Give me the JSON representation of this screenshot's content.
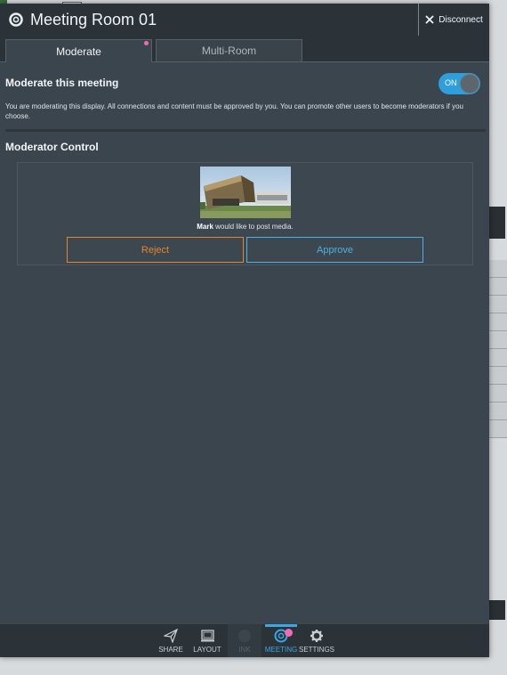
{
  "window": {
    "title": "Meeting Room 01",
    "disconnect_label": "Disconnect"
  },
  "tabs": [
    {
      "label": "Moderate",
      "active": true,
      "badge": true
    },
    {
      "label": "Multi-Room",
      "active": false
    }
  ],
  "moderate": {
    "heading": "Moderate this meeting",
    "toggle_label": "ON",
    "toggle_on": true,
    "description": "You are moderating this display. All connections and content must be approved by you. You can promote other users to become moderators if you choose."
  },
  "moderator_control": {
    "heading": "Moderator Control",
    "request": {
      "user": "Mark",
      "message": " would like to post media.",
      "reject_label": "Reject",
      "approve_label": "Approve"
    }
  },
  "toolbar": {
    "items": [
      {
        "label": "SHARE",
        "icon": "share-icon",
        "state": "normal"
      },
      {
        "label": "LAYOUT",
        "icon": "layout-icon",
        "state": "normal"
      },
      {
        "label": "INK",
        "icon": "ink-icon",
        "state": "disabled"
      },
      {
        "label": "MEETING",
        "icon": "meeting-icon",
        "state": "active"
      },
      {
        "label": "SETTINGS",
        "icon": "settings-icon",
        "state": "normal"
      }
    ]
  },
  "colors": {
    "accent": "#3aa8e4",
    "reject": "#e4852e",
    "approve": "#4fb0e2",
    "badge": "#f06ab8"
  }
}
